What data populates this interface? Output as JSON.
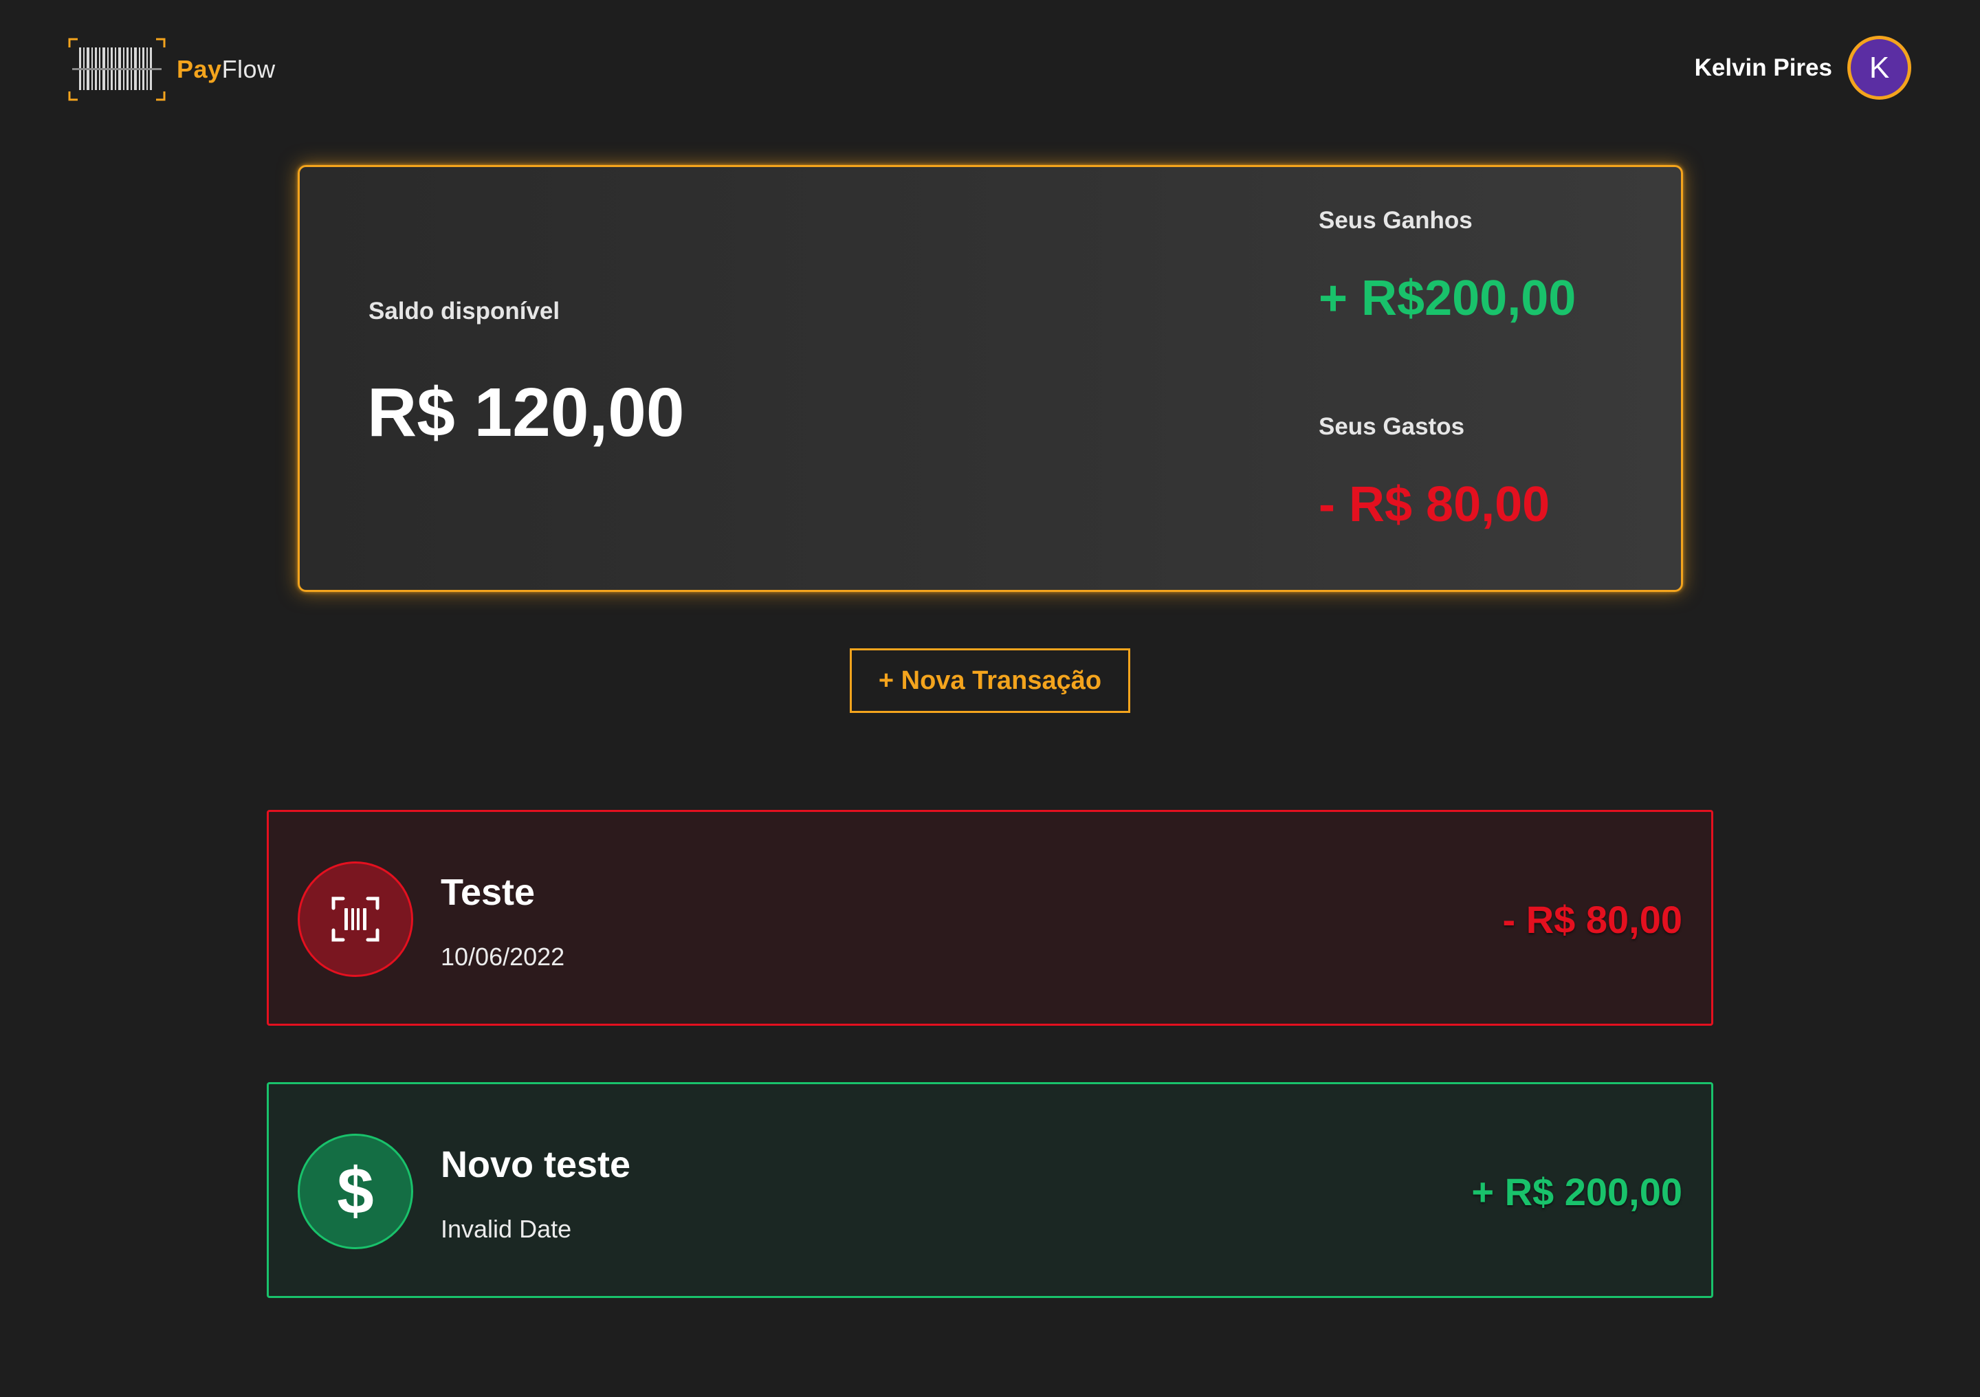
{
  "colors": {
    "background": "#1e1e1e",
    "accent": "#f4a41d",
    "income": "#19c26b",
    "expense": "#e4101f",
    "avatar_bg": "#5b2ea3"
  },
  "header": {
    "logo": {
      "icon": "barcode-scan-icon",
      "text_pay": "Pay",
      "text_flow": "Flow"
    },
    "user": {
      "name": "Kelvin Pires",
      "avatar_initial": "K"
    }
  },
  "balance": {
    "label": "Saldo disponível",
    "value": "R$ 120,00",
    "gains": {
      "label": "Seus Ganhos",
      "value": "+ R$200,00"
    },
    "expenses": {
      "label": "Seus Gastos",
      "value": "- R$ 80,00"
    }
  },
  "actions": {
    "new_transaction_label": "+ Nova Transação"
  },
  "transactions": [
    {
      "type": "expense",
      "icon": "barcode-scan-icon",
      "title": "Teste",
      "date": "10/06/2022",
      "amount": "- R$ 80,00"
    },
    {
      "type": "income",
      "icon": "dollar-icon",
      "title": "Novo teste",
      "date": "Invalid Date",
      "amount": "+ R$ 200,00"
    }
  ]
}
